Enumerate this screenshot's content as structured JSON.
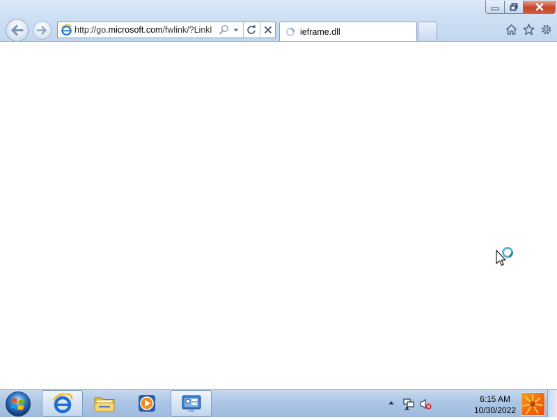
{
  "window": {
    "title": ""
  },
  "caption_buttons": {
    "minimize_icon": "minimize-icon",
    "maximize_icon": "restore-icon",
    "close_icon": "close-icon"
  },
  "navigation": {
    "back_icon": "back-arrow-icon",
    "forward_icon": "forward-arrow-icon"
  },
  "address_bar": {
    "url_prefix": "http://go.",
    "url_domain": "microsoft.com",
    "url_path": "/fwlink/?Linkl",
    "page_icon": "ie-page-icon",
    "search_icon": "search-icon",
    "dropdown_icon": "chevron-down-icon",
    "refresh_icon": "refresh-icon",
    "stop_icon": "close-icon"
  },
  "tabs": [
    {
      "label": "ieframe.dll",
      "state": "loading"
    }
  ],
  "toolbar_right": {
    "home_icon": "home-icon",
    "favorites_icon": "star-icon",
    "tools_icon": "gear-icon"
  },
  "taskbar": {
    "start_icon": "windows-orb-icon",
    "pinned": [
      {
        "name": "Internet Explorer",
        "icon": "ie-icon",
        "active": true
      },
      {
        "name": "Windows Explorer",
        "icon": "folder-icon",
        "active": false
      },
      {
        "name": "Windows Media Player",
        "icon": "media-player-icon",
        "active": false
      },
      {
        "name": "Remote Desktop",
        "icon": "remote-desktop-icon",
        "active": true
      }
    ],
    "tray": {
      "overflow_icon": "chevron-up-icon",
      "network_icon": "network-icon",
      "volume_icon": "volume-muted-icon"
    },
    "clock": {
      "time": "6:15 AM",
      "date": "10/30/2022"
    }
  },
  "colors": {
    "chrome_top": "#dbe8f7",
    "close_button": "#c7442a",
    "taskbar": "#adc7e6",
    "accent": "#1c6fd0"
  }
}
